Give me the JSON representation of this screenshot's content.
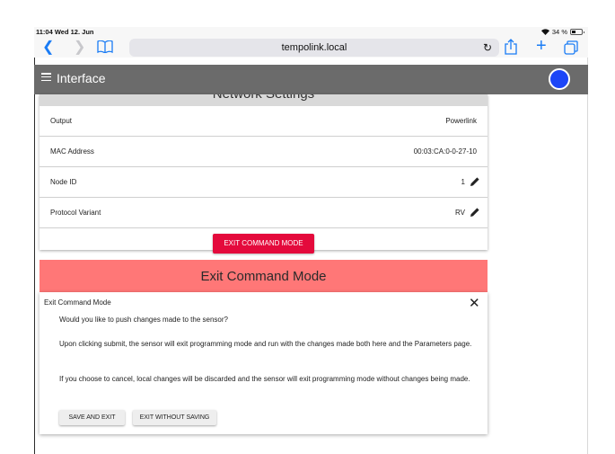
{
  "status_bar": {
    "time_date": "11:04  Wed 12. Jun",
    "battery_text": "34 %"
  },
  "browser": {
    "url": "tempolink.local",
    "icons": [
      "back-icon",
      "forward-icon",
      "bookmarks-icon",
      "reload-icon",
      "share-icon",
      "new-tab-icon",
      "tabs-icon"
    ]
  },
  "app": {
    "title": "Interface",
    "avatar_color": "#1c45f7",
    "header_color": "#6b6b6b"
  },
  "network_settings": {
    "title": "Network Settings",
    "rows": [
      {
        "label": "Output",
        "value": "Powerlink"
      },
      {
        "label": "MAC Address",
        "value": "00:03:CA:0-0-27-10"
      },
      {
        "label": "Node ID",
        "value": "1"
      },
      {
        "label": "Protocol Variant",
        "value": "RV"
      }
    ],
    "exit_button": "EXIT COMMAND MODE",
    "accent_color": "#e40a3c"
  },
  "modal": {
    "banner_title": "Exit Command Mode",
    "banner_color": "#ff7777",
    "title": "Exit Command Mode",
    "paragraph1": "Would you like to push changes made to the sensor?",
    "paragraph2": "Upon clicking submit, the sensor will exit programming mode and run with the changes made both here and the Parameters page.",
    "paragraph3": "If you choose to cancel, local changes will be discarded and the sensor will exit programming mode without changes being made.",
    "save_button": "SAVE AND EXIT",
    "nosave_button": "EXIT WITHOUT SAVING"
  }
}
